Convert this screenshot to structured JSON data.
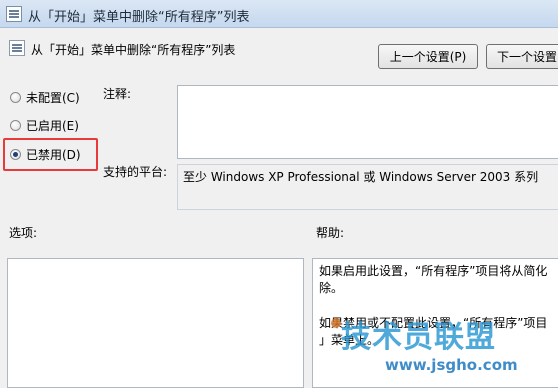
{
  "window": {
    "title": "从「开始」菜单中删除“所有程序”列表"
  },
  "header": {
    "policy_title": "从「开始」菜单中删除“所有程序”列表",
    "prev_button": "上一个设置(P)",
    "next_button": "下一个设置"
  },
  "radios": [
    {
      "label": "未配置(C)",
      "checked": false
    },
    {
      "label": "已启用(E)",
      "checked": false
    },
    {
      "label": "已禁用(D)",
      "checked": true
    }
  ],
  "fields": {
    "comment_label": "注释:",
    "comment_value": "",
    "platform_label": "支持的平台:",
    "platform_value": "至少 Windows XP Professional 或 Windows Server 2003 系列"
  },
  "sections": {
    "options_label": "选项:",
    "help_label": "帮助:"
  },
  "help": {
    "lines": [
      "如果启用此设置，“所有程序”项目将从简化",
      "除。",
      "",
      "如果禁用或不配置此设置，“所有程序”项目",
      "」菜单上。"
    ]
  },
  "watermark": {
    "main": "技术员联盟",
    "url": "www.jsgho.com"
  },
  "colors": {
    "highlight": "#e8393b",
    "titlebar": "#c5d8ee",
    "watermark": "#2896d2"
  }
}
